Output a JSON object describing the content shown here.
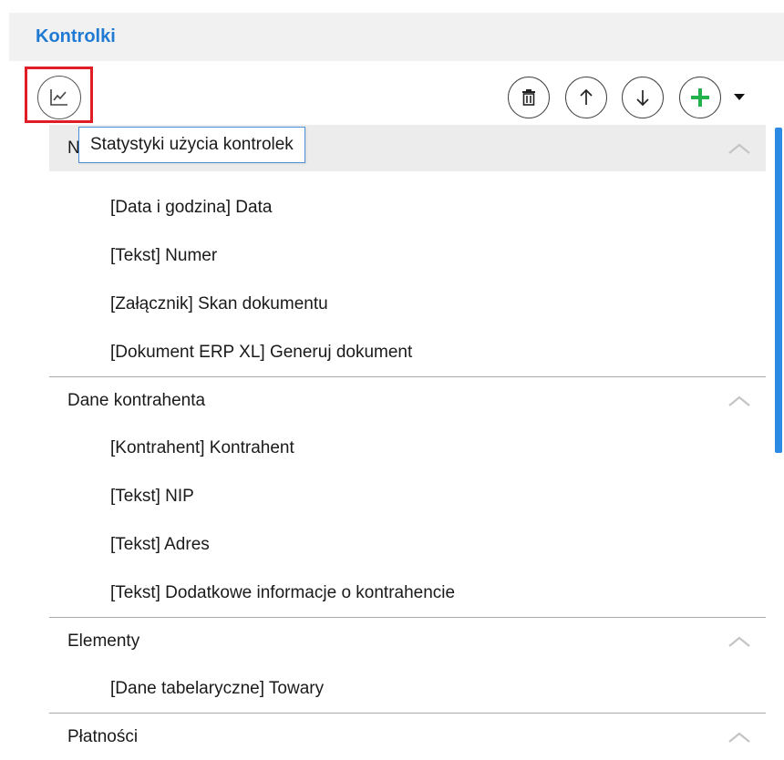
{
  "header": {
    "title": "Kontrolki"
  },
  "toolbar": {
    "stats_icon": "line-chart-icon",
    "delete_icon": "trash-icon",
    "up_icon": "arrow-up-icon",
    "down_icon": "arrow-down-icon",
    "add_icon": "plus-icon",
    "accent_color": "#22b14c",
    "highlight_color": "#e01c24"
  },
  "tooltip": {
    "text": "Statystyki użycia kontrolek"
  },
  "sections": [
    {
      "title": "N",
      "items": [
        "[Data i godzina] Data",
        "[Tekst] Numer",
        "[Załącznik] Skan dokumentu",
        "[Dokument ERP XL] Generuj dokument"
      ]
    },
    {
      "title": "Dane kontrahenta",
      "items": [
        "[Kontrahent] Kontrahent",
        "[Tekst] NIP",
        "[Tekst] Adres",
        "[Tekst] Dodatkowe informacje o kontrahencie"
      ]
    },
    {
      "title": "Elementy",
      "items": [
        "[Dane tabelaryczne] Towary"
      ]
    },
    {
      "title": "Płatności",
      "items": []
    }
  ]
}
